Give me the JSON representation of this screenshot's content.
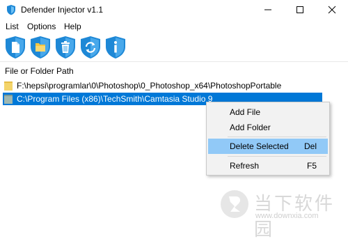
{
  "window": {
    "title": "Defender Injector v1.1",
    "controls": [
      "minimize-icon",
      "maximize-icon",
      "close-icon"
    ]
  },
  "menu": {
    "items": [
      "List",
      "Options",
      "Help"
    ]
  },
  "toolbar": {
    "buttons": [
      {
        "icon": "new-file-shield-icon"
      },
      {
        "icon": "folder-shield-icon"
      },
      {
        "icon": "trash-shield-icon"
      },
      {
        "icon": "refresh-shield-icon"
      },
      {
        "icon": "info-shield-icon"
      }
    ]
  },
  "list": {
    "header": "File or Folder Path",
    "rows": [
      {
        "path": "F:\\hepsi\\programlar\\0\\Photoshop\\0_Photoshop_x64\\PhotoshopPortable",
        "icon": "folder-icon",
        "selected": false
      },
      {
        "path": "C:\\Program Files (x86)\\TechSmith\\Camtasia Studio 9",
        "icon": "folder-icon",
        "selected": true
      }
    ]
  },
  "context_menu": {
    "items": [
      {
        "label": "Add File",
        "shortcut": ""
      },
      {
        "label": "Add Folder",
        "shortcut": ""
      },
      {
        "label": "Delete Selected",
        "shortcut": "Del",
        "highlighted": true
      },
      {
        "label": "Refresh",
        "shortcut": "F5"
      }
    ]
  },
  "watermark": {
    "name": "当下软件园",
    "url": "www.downxia.com"
  },
  "colors": {
    "selection": "#0078d7",
    "menu_highlight": "#91c9f7",
    "shield_blue": "#1e88d6",
    "folder_yellow": "#f4d46a"
  }
}
